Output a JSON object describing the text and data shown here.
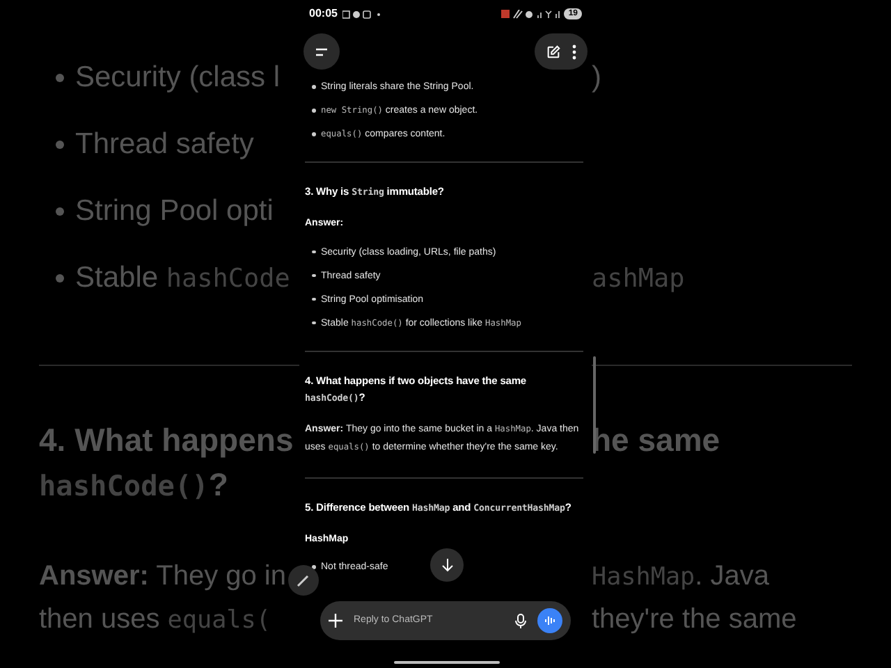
{
  "background": {
    "left": [
      {
        "kind": "bullet",
        "parts": [
          {
            "kind": "plain",
            "text": "Security (class l"
          }
        ]
      },
      {
        "kind": "bullet",
        "parts": [
          {
            "kind": "plain",
            "text": "Thread safety"
          }
        ]
      },
      {
        "kind": "bullet",
        "parts": [
          {
            "kind": "plain",
            "text": "String Pool opti"
          }
        ]
      },
      {
        "kind": "bullet",
        "parts": [
          {
            "kind": "plain",
            "text": "Stable "
          },
          {
            "kind": "code",
            "text": "hashCode"
          }
        ]
      },
      {
        "kind": "divider"
      },
      {
        "kind": "heading",
        "parts": [
          {
            "kind": "plain",
            "text": "4. What happens"
          }
        ]
      },
      {
        "kind": "heading",
        "parts": [
          {
            "kind": "code",
            "text": "hashCode()"
          },
          {
            "kind": "plain",
            "text": "?"
          }
        ]
      },
      {
        "kind": "gap"
      },
      {
        "kind": "para",
        "parts": [
          {
            "kind": "bold",
            "text": "Answer:"
          },
          {
            "kind": "plain",
            "text": " They go in"
          }
        ]
      },
      {
        "kind": "para",
        "parts": [
          {
            "kind": "plain",
            "text": "then uses "
          },
          {
            "kind": "code",
            "text": "equals("
          }
        ]
      }
    ],
    "right": [
      {
        "kind": "bullet",
        "parts": [
          {
            "kind": "plain",
            "text": ")"
          }
        ]
      },
      {
        "kind": "bullet"
      },
      {
        "kind": "bullet"
      },
      {
        "kind": "bullet",
        "parts": [
          {
            "kind": "code",
            "text": "ashMap"
          }
        ]
      },
      {
        "kind": "divider"
      },
      {
        "kind": "heading",
        "parts": [
          {
            "kind": "plain",
            "text": "he same"
          }
        ]
      },
      {
        "kind": "heading"
      },
      {
        "kind": "gap"
      },
      {
        "kind": "para",
        "parts": [
          {
            "kind": "code",
            "text": "HashMap"
          },
          {
            "kind": "plain",
            "text": ". Java"
          }
        ]
      },
      {
        "kind": "para",
        "parts": [
          {
            "kind": "plain",
            "text": "they're the same"
          }
        ]
      }
    ]
  },
  "status_bar": {
    "time": "00:05",
    "battery": "19"
  },
  "chat": [
    {
      "kind": "bullet",
      "parts": [
        {
          "kind": "plain",
          "text": "String literals share the String Pool."
        }
      ]
    },
    {
      "kind": "bullet",
      "parts": [
        {
          "kind": "code",
          "text": "new String()"
        },
        {
          "kind": "plain",
          "text": " creates a new object."
        }
      ]
    },
    {
      "kind": "bullet",
      "parts": [
        {
          "kind": "code",
          "text": "equals()"
        },
        {
          "kind": "plain",
          "text": " compares content."
        }
      ]
    },
    {
      "kind": "divider"
    },
    {
      "kind": "heading",
      "parts": [
        {
          "kind": "plain",
          "text": "3. Why is "
        },
        {
          "kind": "code",
          "text": "String"
        },
        {
          "kind": "plain",
          "text": " immutable?"
        }
      ]
    },
    {
      "kind": "label",
      "parts": [
        {
          "kind": "plain",
          "text": "Answer:"
        }
      ]
    },
    {
      "kind": "bullet",
      "parts": [
        {
          "kind": "plain",
          "text": "Security (class loading, URLs, file paths)"
        }
      ]
    },
    {
      "kind": "bullet",
      "parts": [
        {
          "kind": "plain",
          "text": "Thread safety"
        }
      ]
    },
    {
      "kind": "bullet",
      "parts": [
        {
          "kind": "plain",
          "text": "String Pool optimisation"
        }
      ]
    },
    {
      "kind": "bullet",
      "parts": [
        {
          "kind": "plain",
          "text": "Stable "
        },
        {
          "kind": "code",
          "text": "hashCode()"
        },
        {
          "kind": "plain",
          "text": " for collections like "
        },
        {
          "kind": "code",
          "text": "HashMap"
        }
      ]
    },
    {
      "kind": "divider"
    },
    {
      "kind": "heading",
      "parts": [
        {
          "kind": "plain",
          "text": "4. What happens if two objects have the same "
        },
        {
          "kind": "code",
          "text": "hashCode()"
        },
        {
          "kind": "plain",
          "text": "?"
        }
      ]
    },
    {
      "kind": "para",
      "parts": [
        {
          "kind": "bold",
          "text": "Answer:"
        },
        {
          "kind": "plain",
          "text": " They go into the same bucket in a "
        },
        {
          "kind": "code",
          "text": "HashMap"
        },
        {
          "kind": "plain",
          "text": ". Java then uses "
        },
        {
          "kind": "code",
          "text": "equals()"
        },
        {
          "kind": "plain",
          "text": " to determine whether they're the same key."
        }
      ]
    },
    {
      "kind": "divider"
    },
    {
      "kind": "heading",
      "parts": [
        {
          "kind": "plain",
          "text": "5. Difference between "
        },
        {
          "kind": "code",
          "text": "HashMap"
        },
        {
          "kind": "plain",
          "text": " and "
        },
        {
          "kind": "code",
          "text": "ConcurrentHashMap"
        },
        {
          "kind": "plain",
          "text": "?"
        }
      ]
    },
    {
      "kind": "label",
      "parts": [
        {
          "kind": "plain",
          "text": "HashMap"
        }
      ]
    },
    {
      "kind": "bullet",
      "parts": [
        {
          "kind": "plain",
          "text": "Not thread-safe"
        }
      ]
    }
  ],
  "composer": {
    "placeholder": "Reply to ChatGPT"
  }
}
